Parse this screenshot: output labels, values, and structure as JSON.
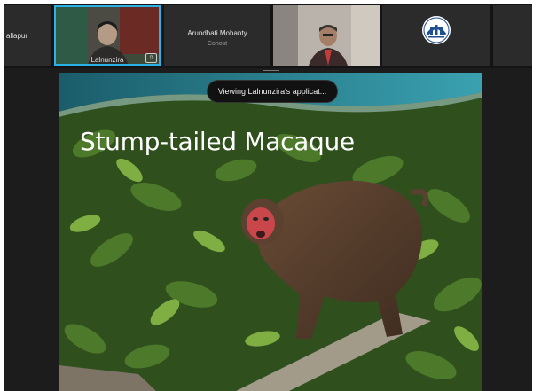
{
  "participants": [
    {
      "name": "allapur",
      "subtitle": ""
    },
    {
      "name": "Lalnunzira",
      "subtitle": "",
      "active_speaker": true
    },
    {
      "name": "Arundhati Mohanty",
      "subtitle": "Cohost"
    },
    {
      "name": "",
      "subtitle": ""
    },
    {
      "name": "",
      "subtitle": "",
      "logo": "institution-seal"
    },
    {
      "name": "",
      "subtitle": ""
    }
  ],
  "pin_icon": "pin-to-screen-icon",
  "share": {
    "banner": "Viewing Lalnunzira's applicat...",
    "slide_title": "Stump-tailed Macaque"
  },
  "colors": {
    "app_background": "#1c1c1c",
    "active_speaker_border": "#2ab2e6",
    "banner_background": "#111111"
  }
}
